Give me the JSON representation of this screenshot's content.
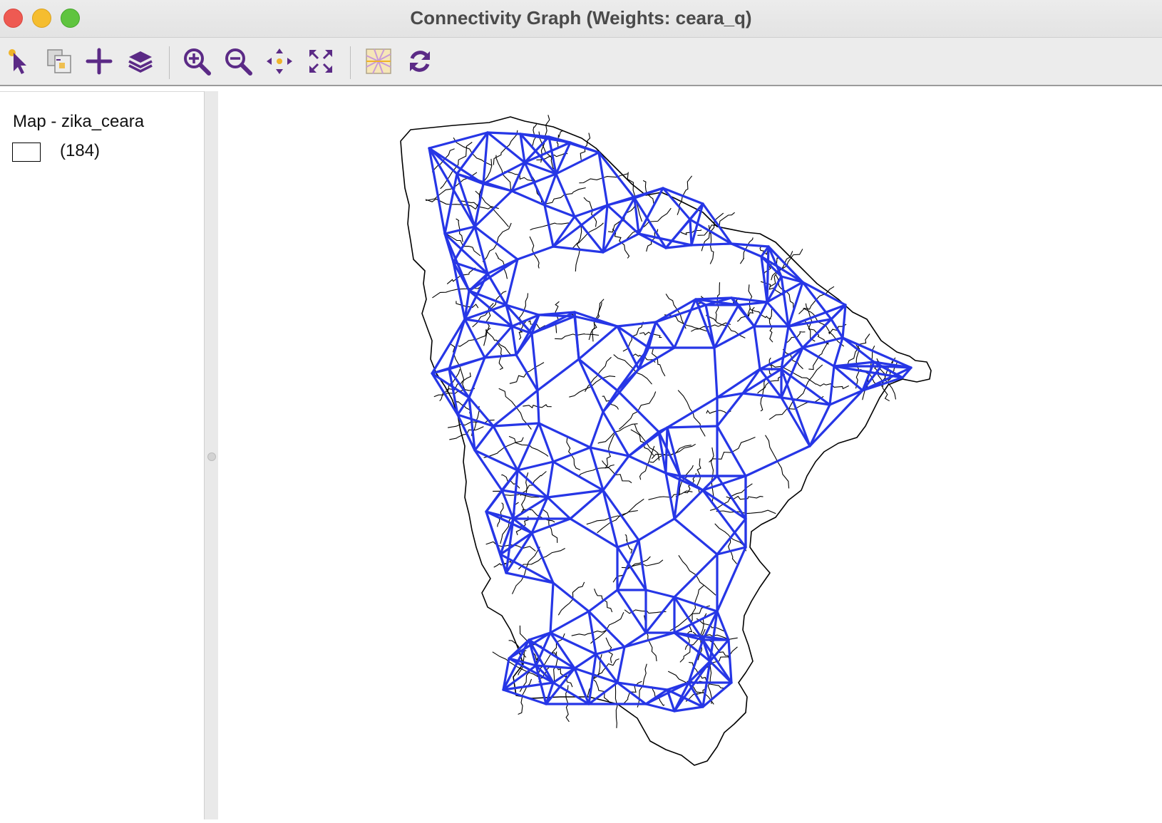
{
  "window": {
    "title": "Connectivity Graph (Weights: ceara_q)"
  },
  "toolbar": {
    "tools": [
      {
        "name": "select-tool",
        "icon": "select-arrow-icon"
      },
      {
        "name": "copy-image-tool",
        "icon": "copy-image-icon"
      },
      {
        "name": "add-tool",
        "icon": "plus-icon"
      },
      {
        "name": "layers-tool",
        "icon": "layers-icon"
      },
      {
        "name": "zoom-in-tool",
        "icon": "zoom-in-icon"
      },
      {
        "name": "zoom-out-tool",
        "icon": "zoom-out-icon"
      },
      {
        "name": "pan-tool",
        "icon": "pan-icon"
      },
      {
        "name": "full-extent-tool",
        "icon": "full-extent-icon"
      },
      {
        "name": "basemap-tool",
        "icon": "basemap-icon"
      },
      {
        "name": "refresh-tool",
        "icon": "refresh-icon"
      }
    ],
    "icon_color": "#5b2a86",
    "accent_color": "#f0b429"
  },
  "legend": {
    "title": "Map - zika_ceara",
    "items": [
      {
        "count_label": "(184)",
        "fill": "#ffffff",
        "outline": "#000000"
      }
    ]
  },
  "map": {
    "layer": "zika_ceara",
    "weights": "ceara_q",
    "polygon_count": 184,
    "edge_color": "#2636e6",
    "polygon_fill": "#ffffff",
    "polygon_outline": "#000000"
  }
}
